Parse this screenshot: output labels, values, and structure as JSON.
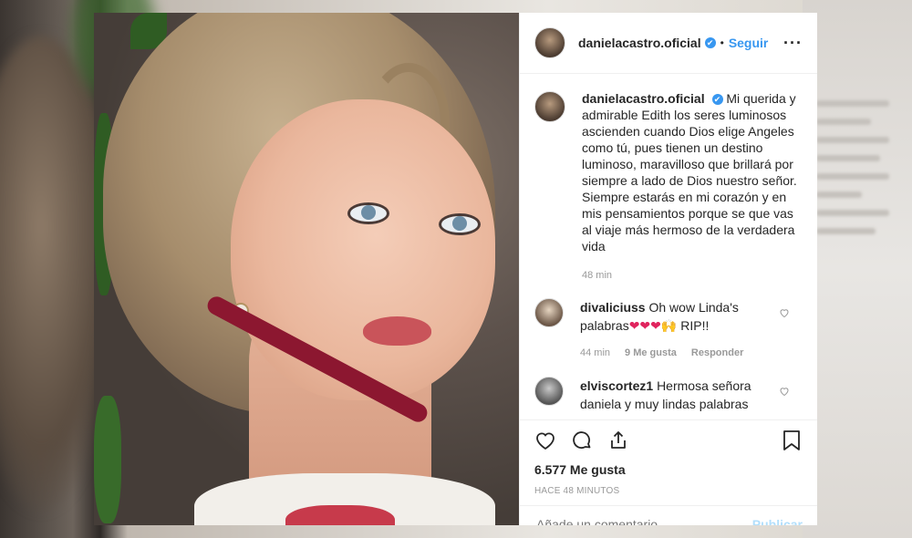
{
  "post": {
    "username": "danielacastro.oficial",
    "verified_glyph": "✔",
    "separator": "•",
    "follow_label": "Seguir",
    "more_glyph": "···"
  },
  "caption": {
    "username": "danielacastro.oficial",
    "text": "Mi querida y admirable Edith los seres luminosos ascienden cuando Dios elige Angeles como tú, pues tienen un destino luminoso, maravilloso que brillará por siempre a lado de Dios nuestro señor. Siempre estarás en mi corazón y en mis pensamientos porque se que vas al viaje más hermoso de la verdadera vida",
    "time": "48 min"
  },
  "comments": [
    {
      "username": "divaliciuss",
      "text": "Oh wow Linda's palabras",
      "hearts": "❤❤❤",
      "emoji_extra": "🙌",
      "tail": " RIP!!",
      "time": "44 min",
      "likes": "9 Me gusta",
      "reply": "Responder"
    },
    {
      "username": "elviscortez1",
      "text": "Hermosa señora daniela y muy lindas palabras",
      "time": "",
      "likes": "",
      "reply": ""
    }
  ],
  "engagement": {
    "likes": "6.577 Me gusta",
    "posted": "HACE 48 MINUTOS"
  },
  "composer": {
    "placeholder": "Añade un comentario...",
    "publish_label": "Publicar"
  },
  "colors": {
    "accent": "#3897f0",
    "heart": "#e0245e",
    "publish_disabled": "#b2dffc"
  }
}
